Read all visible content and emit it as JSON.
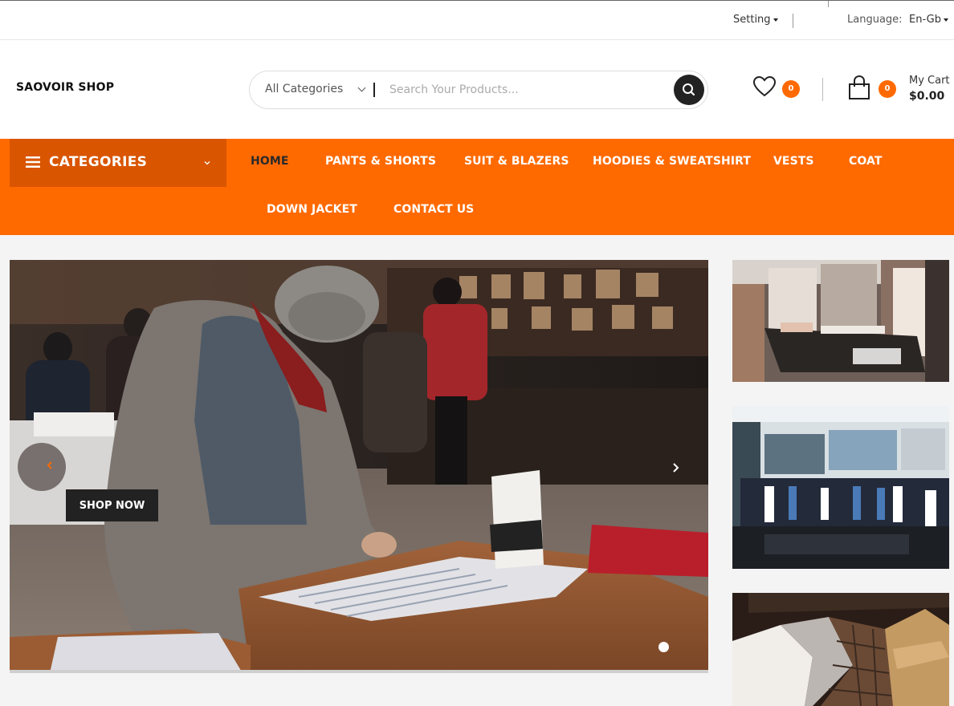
{
  "topbar": {
    "setting_label": "Setting",
    "language_label": "Language:",
    "language_value": "En-Gb"
  },
  "header": {
    "logo_text": "SAOVOIR SHOP",
    "search": {
      "category_selected": "All Categories",
      "placeholder": "Search Your Products..."
    },
    "wishlist_count": "0",
    "cart_count": "0",
    "cart_label": "My Cart",
    "cart_total": "$0.00"
  },
  "nav": {
    "categories_label": "CATEGORIES",
    "items": [
      "HOME",
      "PANTS & SHORTS",
      "SUIT & BLAZERS",
      "HOODIES & SWEATSHIRT",
      "VESTS",
      "COAT",
      "DOWN JACKET",
      "CONTACT US"
    ],
    "active_item": "HOME"
  },
  "hero": {
    "button_label": "SHOP NOW",
    "slide_count": 1,
    "current_slide": 1
  },
  "colors": {
    "accent": "#ff6a00",
    "accent_dark": "#d95500",
    "dark": "#222222"
  },
  "icons": [
    "caret-down-icon",
    "chevron-down-icon",
    "search-icon",
    "heart-icon",
    "shopping-bag-icon",
    "menu-icon",
    "chevron-left-icon",
    "chevron-right-icon"
  ]
}
